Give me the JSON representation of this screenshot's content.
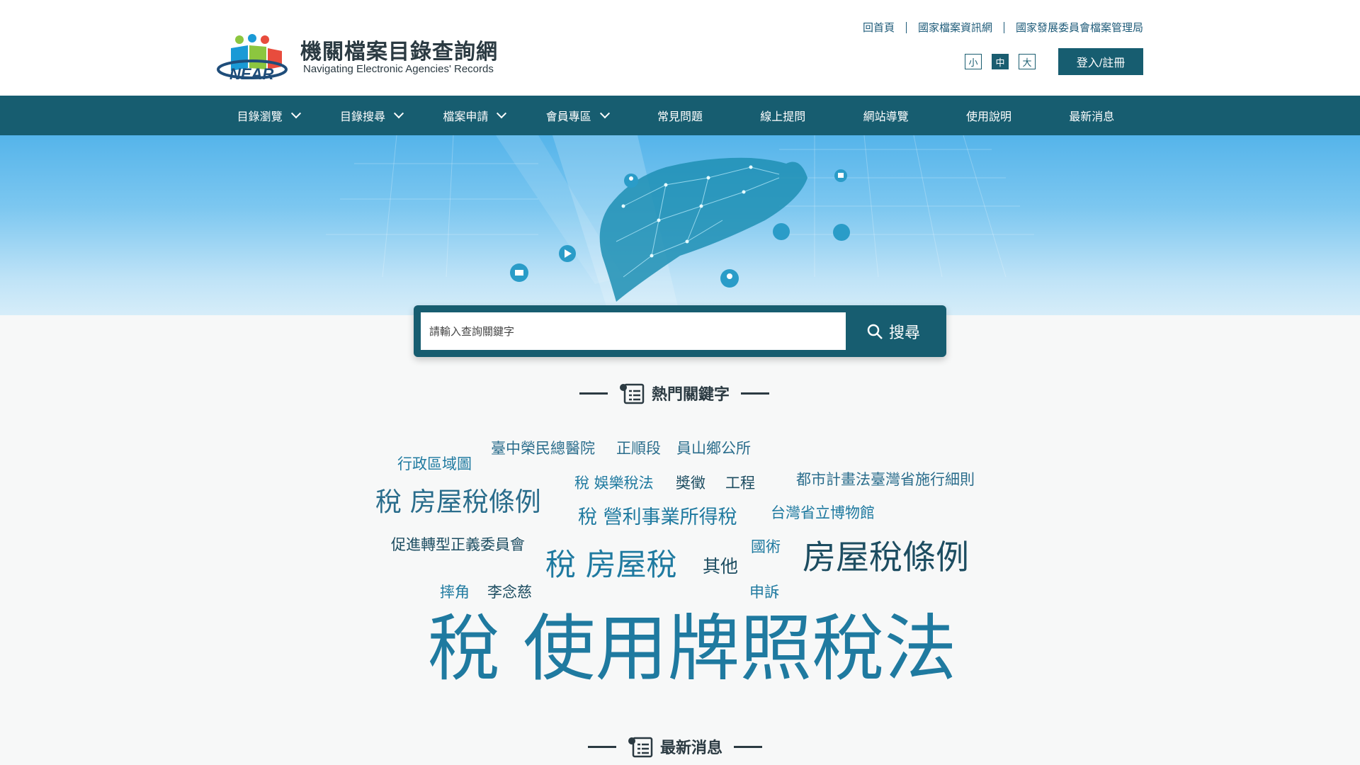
{
  "header": {
    "logo_title": "機關檔案目錄查詢網",
    "logo_subtitle": "Navigating Electronic Agencies' Records",
    "logo_mark_text": "NEAR",
    "top_links": [
      "回首頁",
      "國家檔案資訊網",
      "國家發展委員會檔案管理局"
    ],
    "font_sizes": [
      "小",
      "中",
      "大"
    ],
    "font_size_selected": "中",
    "login_label": "登入/註冊"
  },
  "nav": {
    "items": [
      {
        "label": "目錄瀏覽",
        "has_dropdown": true
      },
      {
        "label": "目錄搜尋",
        "has_dropdown": true
      },
      {
        "label": "檔案申請",
        "has_dropdown": true
      },
      {
        "label": "會員專區",
        "has_dropdown": true
      },
      {
        "label": "常見問題",
        "has_dropdown": false
      },
      {
        "label": "線上提問",
        "has_dropdown": false
      },
      {
        "label": "網站導覽",
        "has_dropdown": false
      },
      {
        "label": "使用說明",
        "has_dropdown": false
      },
      {
        "label": "最新消息",
        "has_dropdown": false
      }
    ]
  },
  "search": {
    "placeholder": "請輸入查詢關鍵字",
    "button_label": "搜尋"
  },
  "hot_keywords": {
    "title": "熱門關鍵字",
    "items": [
      "臺中榮民總醫院",
      "正順段",
      "員山鄉公所",
      "行政區域圖",
      "稅 娛樂稅法",
      "獎徵",
      "工程",
      "都市計畫法臺灣省施行細則",
      "稅 房屋稅條例",
      "稅 營利事業所得稅",
      "台灣省立博物館",
      "促進轉型正義委員會",
      "國術",
      "稅 房屋稅",
      "其他",
      "房屋稅條例",
      "摔角",
      "李念慈",
      "申訴",
      "稅 使用牌照稅法"
    ]
  },
  "news": {
    "title": "最新消息"
  },
  "colors": {
    "primary": "#175d70",
    "keyword_blue": "#1f7aa0",
    "keyword_dark": "#1d4d61"
  }
}
